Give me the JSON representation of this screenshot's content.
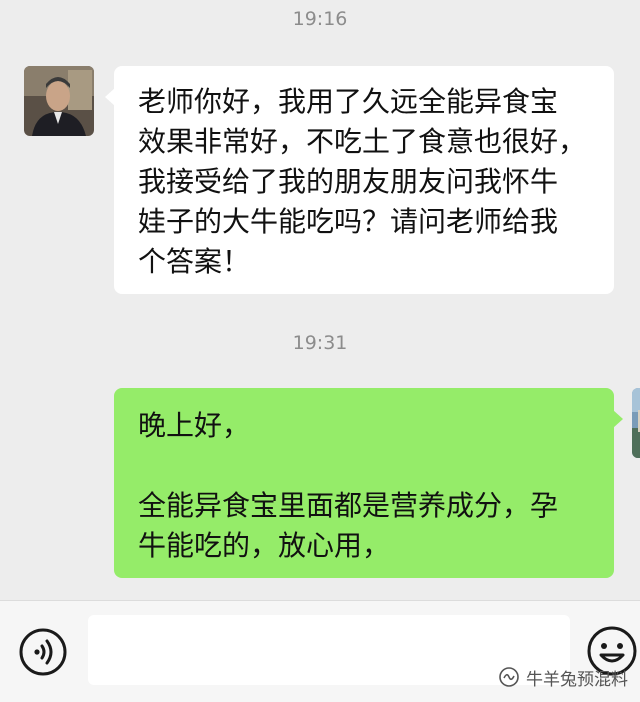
{
  "chat": {
    "messages": [
      {
        "time": "19:16",
        "side": "left",
        "text": "老师你好，我用了久远全能异食宝\n效果非常好，不吃土了食意也很好，\n我接受给了我的朋友朋友问我怀牛\n娃子的大牛能吃吗？请问老师给我\n个答案！"
      },
      {
        "time": "19:31",
        "side": "right",
        "text": "晚上好，\n\n全能异食宝里面都是营养成分，孕\n牛能吃的，放心用，"
      }
    ]
  },
  "input_bar": {
    "voice_icon": "voice-icon",
    "emoji_icon": "emoji-icon"
  },
  "watermark": {
    "text": "牛羊兔预混料",
    "icon": "wechat-official-account-icon"
  },
  "colors": {
    "background": "#ededed",
    "incoming_bubble": "#ffffff",
    "outgoing_bubble": "#95ec69",
    "timestamp": "#8c8c8c"
  }
}
